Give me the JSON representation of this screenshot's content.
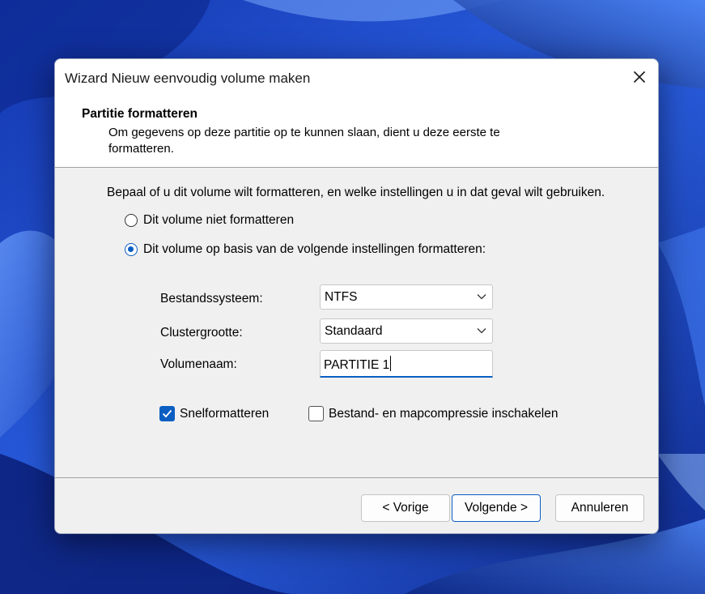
{
  "window": {
    "title": "Wizard Nieuw eenvoudig volume maken"
  },
  "header": {
    "step_title": "Partitie formatteren",
    "step_description": "Om gegevens op deze partitie op te kunnen slaan, dient u deze eerste te formatteren."
  },
  "content": {
    "intro": "Bepaal of u dit volume wilt formatteren, en welke instellingen u in dat geval wilt gebruiken.",
    "radio_options": [
      {
        "label": "Dit volume niet formatteren",
        "selected": false
      },
      {
        "label": "Dit volume op basis van de volgende instellingen formatteren:",
        "selected": true
      }
    ],
    "filesystem": {
      "label": "Bestandssysteem:",
      "value": "NTFS"
    },
    "cluster_size": {
      "label": "Clustergrootte:",
      "value": "Standaard"
    },
    "volume_name": {
      "label": "Volumenaam:",
      "value": "PARTITIE 1"
    },
    "quick_format": {
      "label": "Snelformatteren",
      "checked": true
    },
    "compression": {
      "label": "Bestand- en mapcompressie inschakelen",
      "checked": false
    }
  },
  "buttons": {
    "back": "< Vorige",
    "next": "Volgende >",
    "cancel": "Annuleren"
  },
  "colors": {
    "accent": "#0a5ec2",
    "wallpaper": "#1e3fbf",
    "dialog_bg": "#f0f0f0",
    "header_bg": "#ffffff"
  },
  "icons": {
    "close": "close-icon",
    "dropdown": "chevron-down-icon",
    "check": "checkmark-icon"
  }
}
